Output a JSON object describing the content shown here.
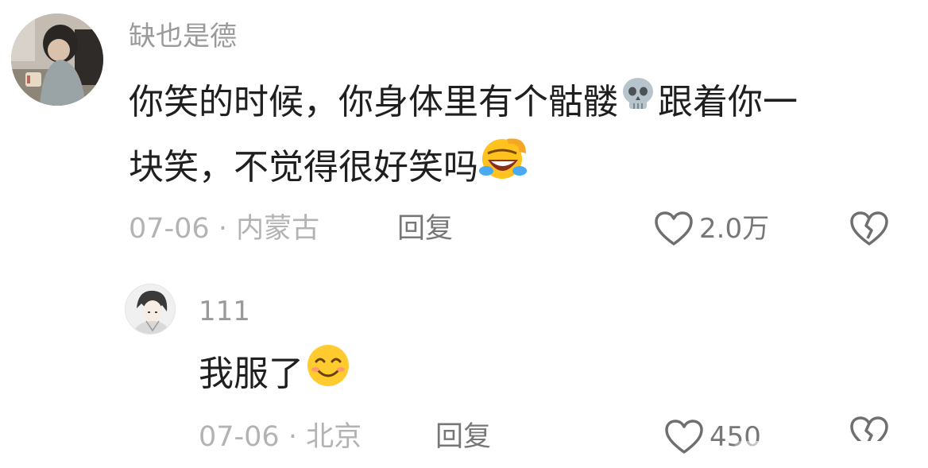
{
  "comment": {
    "username": "缺也是德",
    "line1": "你笑的时候，你身体里有个骷髅",
    "line1_tail": "跟着你一",
    "line2": "块笑，不觉得很好笑吗",
    "date": "07-06",
    "separator": "·",
    "location": "内蒙古",
    "reply_label": "回复",
    "like_count": "2.0万",
    "emoji_1": "skull-emoji",
    "emoji_2": "rolling-laughing-emoji"
  },
  "reply": {
    "username": "111",
    "text": "我服了",
    "date": "07-06",
    "separator": "·",
    "location": "北京",
    "reply_label": "回复",
    "like_count": "450",
    "emoji": "smiling-face-emoji"
  },
  "colors": {
    "username": "#9a9a9a",
    "text": "#1f1f1f",
    "meta": "#b3b3b3",
    "action": "#777777",
    "icon": "#6f6f6f"
  }
}
